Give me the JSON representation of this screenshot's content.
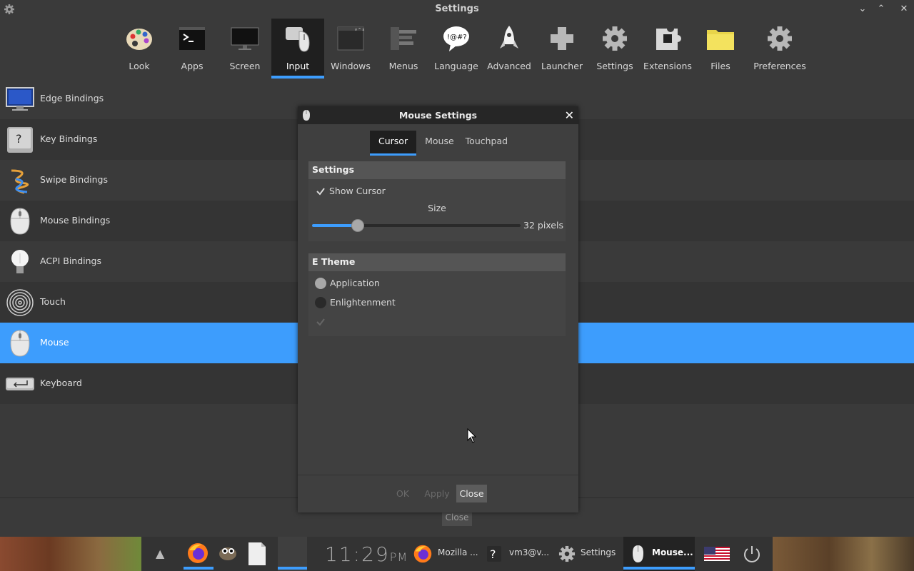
{
  "window": {
    "title": "Settings"
  },
  "categories": [
    {
      "label": "Look",
      "icon": "palette-icon"
    },
    {
      "label": "Apps",
      "icon": "terminal-icon"
    },
    {
      "label": "Screen",
      "icon": "monitor-icon"
    },
    {
      "label": "Input",
      "icon": "keyboard-mouse-icon",
      "active": true
    },
    {
      "label": "Windows",
      "icon": "window-icon"
    },
    {
      "label": "Menus",
      "icon": "menu-icon"
    },
    {
      "label": "Language",
      "icon": "speech-bubble-icon"
    },
    {
      "label": "Advanced",
      "icon": "rocket-icon"
    },
    {
      "label": "Launcher",
      "icon": "launcher-puzzle-icon"
    },
    {
      "label": "Settings",
      "icon": "gear-icon"
    },
    {
      "label": "Extensions",
      "icon": "puzzle-icon"
    },
    {
      "label": "Files",
      "icon": "folder-icon"
    },
    {
      "label": "Preferences",
      "icon": "gear-icon"
    }
  ],
  "list": [
    {
      "label": "Edge Bindings",
      "icon": "monitor-edge-icon"
    },
    {
      "label": "Key Bindings",
      "icon": "key-icon"
    },
    {
      "label": "Swipe Bindings",
      "icon": "swipe-icon"
    },
    {
      "label": "Mouse Bindings",
      "icon": "mouse-icon"
    },
    {
      "label": "ACPI Bindings",
      "icon": "lightbulb-icon"
    },
    {
      "label": "Touch",
      "icon": "fingerprint-icon"
    },
    {
      "label": "Mouse",
      "icon": "mouse-icon",
      "selected": true
    },
    {
      "label": "Keyboard",
      "icon": "keyboard-icon"
    }
  ],
  "ghost_close": "Close",
  "dialog": {
    "title": "Mouse Settings",
    "tabs": [
      "Cursor",
      "Mouse",
      "Touchpad"
    ],
    "active_tab": "Cursor",
    "settings": {
      "header": "Settings",
      "show_cursor_label": "Show Cursor",
      "show_cursor_checked": true,
      "size_label": "Size",
      "size_value_text": "32 pixels",
      "size_fraction": 0.22
    },
    "theme": {
      "header": "E Theme",
      "options": [
        "Application",
        "Enlightenment"
      ],
      "selected": "Application"
    },
    "buttons": {
      "ok": "OK",
      "apply": "Apply",
      "close": "Close"
    }
  },
  "taskbar": {
    "clock_time": "11:29",
    "clock_ampm": "PM",
    "windows": [
      {
        "label": "Mozilla ...",
        "icon": "firefox-icon"
      },
      {
        "label": "vm3@v...",
        "icon": "question-icon"
      },
      {
        "label": "Settings",
        "icon": "gear-icon"
      },
      {
        "label": "Mouse...",
        "icon": "mouse-icon",
        "active": true
      }
    ],
    "colors": {
      "accent": "#3d9dfd"
    }
  }
}
